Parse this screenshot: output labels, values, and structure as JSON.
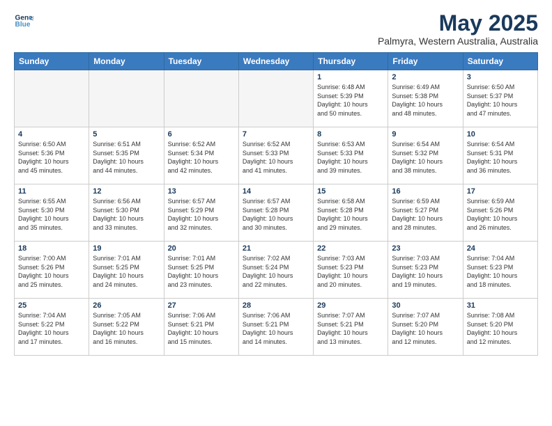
{
  "header": {
    "logo_line1": "General",
    "logo_line2": "Blue",
    "month_title": "May 2025",
    "subtitle": "Palmyra, Western Australia, Australia"
  },
  "weekdays": [
    "Sunday",
    "Monday",
    "Tuesday",
    "Wednesday",
    "Thursday",
    "Friday",
    "Saturday"
  ],
  "weeks": [
    [
      {
        "day": "",
        "info": ""
      },
      {
        "day": "",
        "info": ""
      },
      {
        "day": "",
        "info": ""
      },
      {
        "day": "",
        "info": ""
      },
      {
        "day": "1",
        "info": "Sunrise: 6:48 AM\nSunset: 5:39 PM\nDaylight: 10 hours\nand 50 minutes."
      },
      {
        "day": "2",
        "info": "Sunrise: 6:49 AM\nSunset: 5:38 PM\nDaylight: 10 hours\nand 48 minutes."
      },
      {
        "day": "3",
        "info": "Sunrise: 6:50 AM\nSunset: 5:37 PM\nDaylight: 10 hours\nand 47 minutes."
      }
    ],
    [
      {
        "day": "4",
        "info": "Sunrise: 6:50 AM\nSunset: 5:36 PM\nDaylight: 10 hours\nand 45 minutes."
      },
      {
        "day": "5",
        "info": "Sunrise: 6:51 AM\nSunset: 5:35 PM\nDaylight: 10 hours\nand 44 minutes."
      },
      {
        "day": "6",
        "info": "Sunrise: 6:52 AM\nSunset: 5:34 PM\nDaylight: 10 hours\nand 42 minutes."
      },
      {
        "day": "7",
        "info": "Sunrise: 6:52 AM\nSunset: 5:33 PM\nDaylight: 10 hours\nand 41 minutes."
      },
      {
        "day": "8",
        "info": "Sunrise: 6:53 AM\nSunset: 5:33 PM\nDaylight: 10 hours\nand 39 minutes."
      },
      {
        "day": "9",
        "info": "Sunrise: 6:54 AM\nSunset: 5:32 PM\nDaylight: 10 hours\nand 38 minutes."
      },
      {
        "day": "10",
        "info": "Sunrise: 6:54 AM\nSunset: 5:31 PM\nDaylight: 10 hours\nand 36 minutes."
      }
    ],
    [
      {
        "day": "11",
        "info": "Sunrise: 6:55 AM\nSunset: 5:30 PM\nDaylight: 10 hours\nand 35 minutes."
      },
      {
        "day": "12",
        "info": "Sunrise: 6:56 AM\nSunset: 5:30 PM\nDaylight: 10 hours\nand 33 minutes."
      },
      {
        "day": "13",
        "info": "Sunrise: 6:57 AM\nSunset: 5:29 PM\nDaylight: 10 hours\nand 32 minutes."
      },
      {
        "day": "14",
        "info": "Sunrise: 6:57 AM\nSunset: 5:28 PM\nDaylight: 10 hours\nand 30 minutes."
      },
      {
        "day": "15",
        "info": "Sunrise: 6:58 AM\nSunset: 5:28 PM\nDaylight: 10 hours\nand 29 minutes."
      },
      {
        "day": "16",
        "info": "Sunrise: 6:59 AM\nSunset: 5:27 PM\nDaylight: 10 hours\nand 28 minutes."
      },
      {
        "day": "17",
        "info": "Sunrise: 6:59 AM\nSunset: 5:26 PM\nDaylight: 10 hours\nand 26 minutes."
      }
    ],
    [
      {
        "day": "18",
        "info": "Sunrise: 7:00 AM\nSunset: 5:26 PM\nDaylight: 10 hours\nand 25 minutes."
      },
      {
        "day": "19",
        "info": "Sunrise: 7:01 AM\nSunset: 5:25 PM\nDaylight: 10 hours\nand 24 minutes."
      },
      {
        "day": "20",
        "info": "Sunrise: 7:01 AM\nSunset: 5:25 PM\nDaylight: 10 hours\nand 23 minutes."
      },
      {
        "day": "21",
        "info": "Sunrise: 7:02 AM\nSunset: 5:24 PM\nDaylight: 10 hours\nand 22 minutes."
      },
      {
        "day": "22",
        "info": "Sunrise: 7:03 AM\nSunset: 5:23 PM\nDaylight: 10 hours\nand 20 minutes."
      },
      {
        "day": "23",
        "info": "Sunrise: 7:03 AM\nSunset: 5:23 PM\nDaylight: 10 hours\nand 19 minutes."
      },
      {
        "day": "24",
        "info": "Sunrise: 7:04 AM\nSunset: 5:23 PM\nDaylight: 10 hours\nand 18 minutes."
      }
    ],
    [
      {
        "day": "25",
        "info": "Sunrise: 7:04 AM\nSunset: 5:22 PM\nDaylight: 10 hours\nand 17 minutes."
      },
      {
        "day": "26",
        "info": "Sunrise: 7:05 AM\nSunset: 5:22 PM\nDaylight: 10 hours\nand 16 minutes."
      },
      {
        "day": "27",
        "info": "Sunrise: 7:06 AM\nSunset: 5:21 PM\nDaylight: 10 hours\nand 15 minutes."
      },
      {
        "day": "28",
        "info": "Sunrise: 7:06 AM\nSunset: 5:21 PM\nDaylight: 10 hours\nand 14 minutes."
      },
      {
        "day": "29",
        "info": "Sunrise: 7:07 AM\nSunset: 5:21 PM\nDaylight: 10 hours\nand 13 minutes."
      },
      {
        "day": "30",
        "info": "Sunrise: 7:07 AM\nSunset: 5:20 PM\nDaylight: 10 hours\nand 12 minutes."
      },
      {
        "day": "31",
        "info": "Sunrise: 7:08 AM\nSunset: 5:20 PM\nDaylight: 10 hours\nand 12 minutes."
      }
    ]
  ]
}
